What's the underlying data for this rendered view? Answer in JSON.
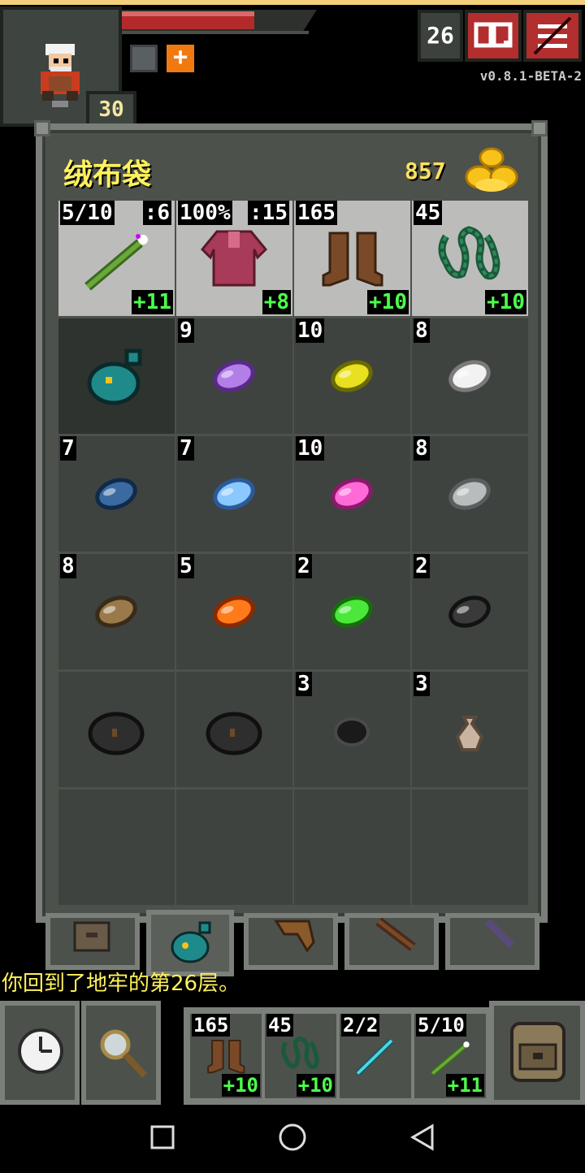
{
  "status": {
    "depth": "26",
    "level": "30",
    "version": "v0.8.1-BETA-2",
    "hp_fraction": 0.68
  },
  "buffs": [
    {
      "icon": "ring-buff-icon"
    },
    {
      "icon": "heal-cross-icon",
      "label": "+"
    }
  ],
  "bag": {
    "title": "绒布袋",
    "gold": "857",
    "equipped": [
      {
        "icon": "wand-icon",
        "tl": "5/10",
        "tr": ":6",
        "br": "+11"
      },
      {
        "icon": "robe-armor-icon",
        "tl": "100%",
        "tr": ":15",
        "br": "+8"
      },
      {
        "icon": "boots-icon",
        "tl": "165",
        "tr": "",
        "br": "+10"
      },
      {
        "icon": "chain-ring-icon",
        "tl": "45",
        "tr": "",
        "br": "+10"
      }
    ],
    "rows": [
      [
        {
          "icon": "velvet-pouch-icon",
          "tl": "",
          "selected": true
        },
        {
          "icon": "purple-seed-icon",
          "tl": "9"
        },
        {
          "icon": "yellow-seed-icon",
          "tl": "10"
        },
        {
          "icon": "white-seed-icon",
          "tl": "8"
        }
      ],
      [
        {
          "icon": "navy-seed-icon",
          "tl": "7"
        },
        {
          "icon": "light-blue-seed-icon",
          "tl": "7"
        },
        {
          "icon": "pink-seed-icon",
          "tl": "10"
        },
        {
          "icon": "gray-seed-icon",
          "tl": "8"
        }
      ],
      [
        {
          "icon": "brown-seed-icon",
          "tl": "8"
        },
        {
          "icon": "orange-seed-icon",
          "tl": "5"
        },
        {
          "icon": "green-seed-icon",
          "tl": "2"
        },
        {
          "icon": "dark-seed-icon",
          "tl": "2"
        }
      ],
      [
        {
          "icon": "dark-stone-icon",
          "tl": ""
        },
        {
          "icon": "dark-stone-icon",
          "tl": ""
        },
        {
          "icon": "black-bomb-icon",
          "tl": "3"
        },
        {
          "icon": "honey-pot-icon",
          "tl": "3"
        }
      ],
      [
        {
          "icon": "empty",
          "tl": ""
        },
        {
          "icon": "empty",
          "tl": ""
        },
        {
          "icon": "empty",
          "tl": ""
        },
        {
          "icon": "empty",
          "tl": ""
        }
      ]
    ],
    "tabs": [
      {
        "icon": "backpack-tab-icon"
      },
      {
        "icon": "velvet-pouch-tab-icon"
      },
      {
        "icon": "scroll-holder-tab-icon"
      },
      {
        "icon": "potion-bandolier-tab-icon"
      },
      {
        "icon": "wand-holster-tab-icon"
      }
    ]
  },
  "log": "你回到了地牢的第26层。",
  "quickslots": [
    {
      "icon": "boots-icon",
      "tl": "165",
      "br": "+10"
    },
    {
      "icon": "chain-ring-icon",
      "tl": "45",
      "br": "+10"
    },
    {
      "icon": "cyan-wand-icon",
      "tl": "2/2",
      "br": ""
    },
    {
      "icon": "wand-icon",
      "tl": "5/10",
      "br": "+11"
    }
  ],
  "colors": {
    "gold_text": "#ffe15a",
    "bonus_text": "#4dff4d",
    "title_text": "#fff25a",
    "hp": "#b42a2a"
  }
}
